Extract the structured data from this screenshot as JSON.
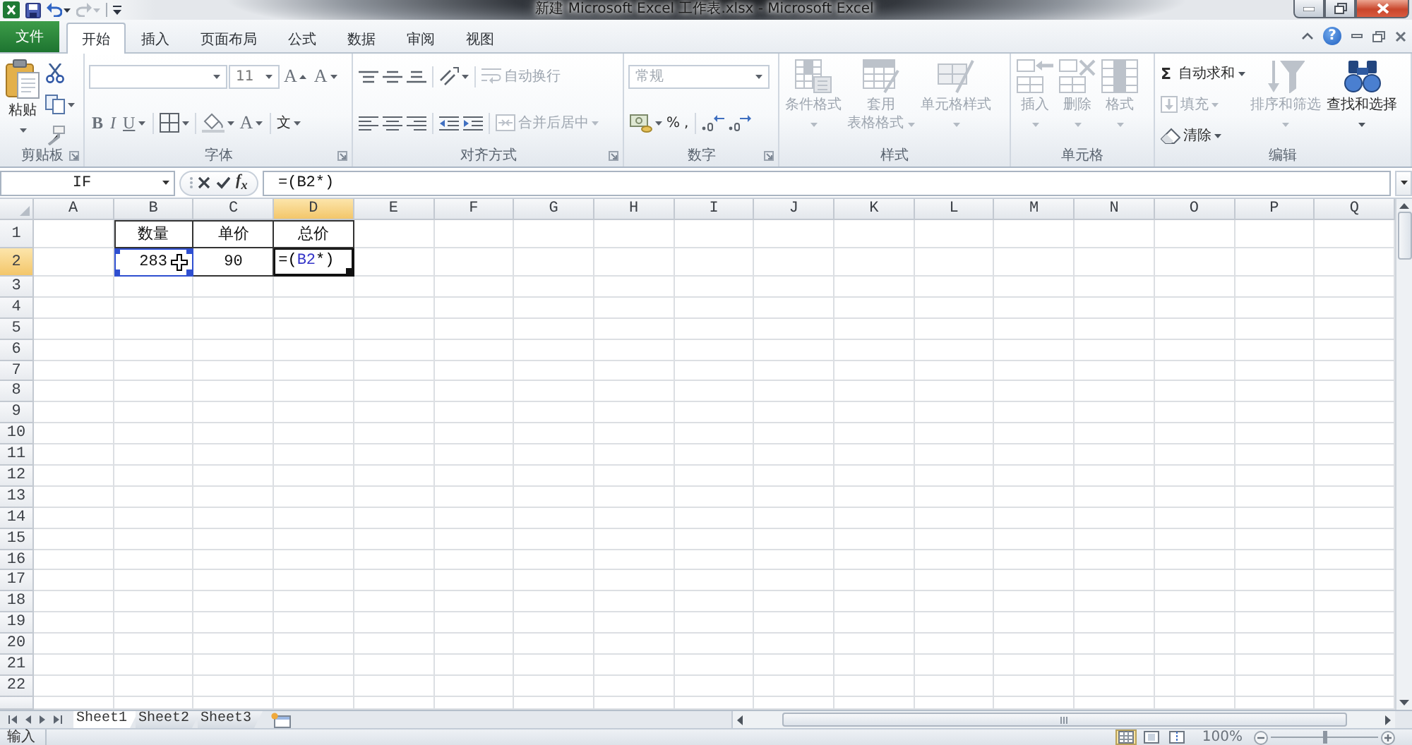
{
  "window": {
    "title": "新建 Microsoft Excel 工作表.xlsx - Microsoft Excel"
  },
  "ribbon_tabs": [
    {
      "label": "文件",
      "kind": "file",
      "selected": false
    },
    {
      "label": "开始",
      "kind": "tab",
      "selected": true
    },
    {
      "label": "插入",
      "kind": "tab",
      "selected": false
    },
    {
      "label": "页面布局",
      "kind": "tab",
      "selected": false
    },
    {
      "label": "公式",
      "kind": "tab",
      "selected": false
    },
    {
      "label": "数据",
      "kind": "tab",
      "selected": false
    },
    {
      "label": "审阅",
      "kind": "tab",
      "selected": false
    },
    {
      "label": "视图",
      "kind": "tab",
      "selected": false
    }
  ],
  "help_button": "?",
  "ribbon": {
    "clipboard": {
      "label": "剪贴板",
      "paste": {
        "label": "粘贴",
        "disabled": false
      }
    },
    "font": {
      "label": "字体",
      "font_size": "11",
      "grow": "A",
      "shrink": "A",
      "bold": "B",
      "italic": "I",
      "underline": "U",
      "font_color": "A",
      "phonetic": "文"
    },
    "alignment": {
      "label": "对齐方式",
      "wrap_text": {
        "label": "自动换行",
        "disabled": true
      },
      "merge": {
        "label": "合并后居中",
        "disabled": true
      }
    },
    "number": {
      "label": "数字",
      "format": {
        "value": "常规",
        "disabled": true
      },
      "percent": "%",
      "comma": ","
    },
    "styles": {
      "label": "样式",
      "buttons": [
        {
          "kind": "conditional",
          "lines": [
            "条件格式"
          ],
          "disabled": true
        },
        {
          "kind": "table",
          "lines": [
            "套用",
            "表格格式"
          ],
          "disabled": true
        },
        {
          "kind": "cell",
          "lines": [
            "单元格样式"
          ],
          "disabled": true
        }
      ]
    },
    "cells": {
      "label": "单元格",
      "buttons": [
        {
          "kind": "insert",
          "lines": [
            "插入"
          ],
          "disabled": true
        },
        {
          "kind": "delete",
          "lines": [
            "删除"
          ],
          "disabled": true
        },
        {
          "kind": "format",
          "lines": [
            "格式"
          ],
          "disabled": true
        }
      ]
    },
    "editing": {
      "label": "编辑",
      "small": [
        {
          "kind": "sum",
          "glyph": "Σ",
          "label": "自动求和",
          "disabled": false
        },
        {
          "kind": "fill",
          "label": "填充",
          "disabled": true
        },
        {
          "kind": "clear",
          "label": "清除",
          "disabled": false
        }
      ],
      "large": [
        {
          "kind": "sort",
          "lines": [
            "排序和筛选"
          ],
          "disabled": true
        },
        {
          "kind": "find",
          "lines": [
            "查找和选择"
          ],
          "disabled": false
        }
      ]
    }
  },
  "formula_bar": {
    "name_box": "IF",
    "function_button": "f$_{x}$",
    "formula": "=(B2*)"
  },
  "sheet": {
    "columns": [
      {
        "label": "A",
        "selected": false
      },
      {
        "label": "B",
        "selected": false
      },
      {
        "label": "C",
        "selected": false
      },
      {
        "label": "D",
        "selected": true
      },
      {
        "label": "E",
        "selected": false
      },
      {
        "label": "F",
        "selected": false
      },
      {
        "label": "G",
        "selected": false
      },
      {
        "label": "H",
        "selected": false
      },
      {
        "label": "I",
        "selected": false
      },
      {
        "label": "J",
        "selected": false
      },
      {
        "label": "K",
        "selected": false
      },
      {
        "label": "L",
        "selected": false
      },
      {
        "label": "M",
        "selected": false
      },
      {
        "label": "N",
        "selected": false
      },
      {
        "label": "O",
        "selected": false
      },
      {
        "label": "P",
        "selected": false
      },
      {
        "label": "Q",
        "selected": false
      }
    ],
    "rows": [
      {
        "label": "1",
        "selected": false,
        "cells": [
          {
            "kind": "value",
            "text": "数量",
            "selected": false,
            "referenced": false
          },
          {
            "kind": "value",
            "text": "单价",
            "selected": false,
            "referenced": false
          },
          {
            "kind": "value",
            "text": "总价",
            "selected": false,
            "referenced": false
          }
        ]
      },
      {
        "label": "2",
        "selected": true,
        "cells": [
          {
            "kind": "value",
            "text": "283",
            "selected": false,
            "referenced": true
          },
          {
            "kind": "value",
            "text": "90",
            "selected": false,
            "referenced": false
          },
          {
            "kind": "formula",
            "segments": [
              {
                "text": "=(",
                "color": "#000000"
              },
              {
                "text": "B2",
                "color": "#3535c8"
              },
              {
                "text": "*)",
                "color": "#000000"
              }
            ],
            "selected": true,
            "referenced": false
          }
        ]
      },
      {
        "label": "3",
        "selected": false
      },
      {
        "label": "4",
        "selected": false
      },
      {
        "label": "5",
        "selected": false
      },
      {
        "label": "6",
        "selected": false
      },
      {
        "label": "7",
        "selected": false
      },
      {
        "label": "8",
        "selected": false
      },
      {
        "label": "9",
        "selected": false
      },
      {
        "label": "10",
        "selected": false
      },
      {
        "label": "11",
        "selected": false
      },
      {
        "label": "12",
        "selected": false
      },
      {
        "label": "13",
        "selected": false
      },
      {
        "label": "14",
        "selected": false
      },
      {
        "label": "15",
        "selected": false
      },
      {
        "label": "16",
        "selected": false
      },
      {
        "label": "17",
        "selected": false
      },
      {
        "label": "18",
        "selected": false
      },
      {
        "label": "19",
        "selected": false
      },
      {
        "label": "20",
        "selected": false
      },
      {
        "label": "21",
        "selected": false
      },
      {
        "label": "22",
        "selected": false
      }
    ]
  },
  "sheet_tabs": [
    {
      "label": "Sheet1",
      "selected": true
    },
    {
      "label": "Sheet2",
      "selected": false
    },
    {
      "label": "Sheet3",
      "selected": false
    }
  ],
  "status_bar": {
    "mode": "输入",
    "views": [
      {
        "kind": "normal",
        "selected": true
      },
      {
        "kind": "page_layout",
        "selected": false
      },
      {
        "kind": "page_break",
        "selected": false
      }
    ],
    "zoom": "100%",
    "zoom_slider": {
      "level": 0.5
    }
  }
}
